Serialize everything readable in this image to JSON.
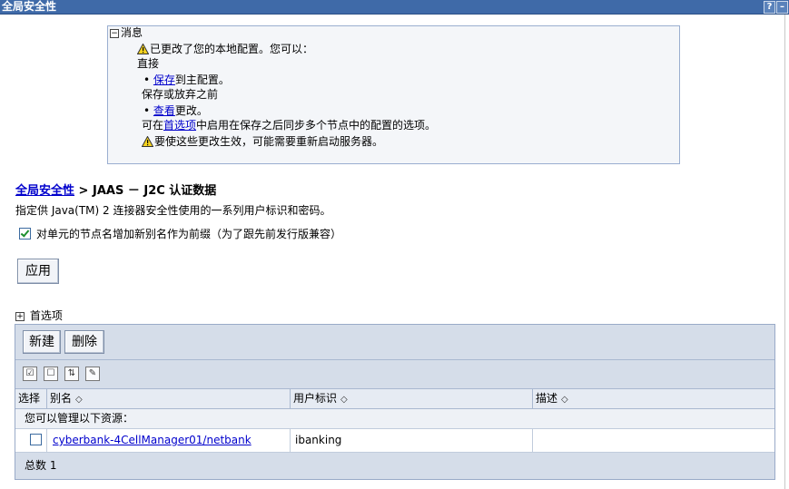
{
  "window": {
    "title": "全局安全性",
    "help_button": "?",
    "minimize_button": "–"
  },
  "message": {
    "header": "消息",
    "line1": "已更改了您的本地配置。您可以：",
    "line2": "直接",
    "save_link": "保存",
    "save_suffix": "到主配置。",
    "line4": "保存或放弃之前",
    "review_link": "查看",
    "review_suffix": "更改。",
    "pref_prefix": "可在",
    "pref_link": "首选项",
    "pref_suffix": "中启用在保存之后同步多个节点中的配置的选项。",
    "restart": "要使这些更改生效，可能需要重新启动服务器。"
  },
  "breadcrumb": {
    "link": "全局安全性",
    "separator": ">",
    "current": "JAAS － J2C 认证数据"
  },
  "description": "指定供 Java(TM) 2 连接器安全性使用的一系列用户标识和密码。",
  "checkbox": {
    "label": "对单元的节点名增加新别名作为前缀（为了跟先前发行版兼容）",
    "checked": true
  },
  "apply_button": "应用",
  "preferences": {
    "label": "首选项"
  },
  "toolbar": {
    "new_button": "新建",
    "delete_button": "删除"
  },
  "table": {
    "columns": [
      "选择",
      "别名",
      "用户标识",
      "描述"
    ],
    "info_text": "您可以管理以下资源：",
    "rows": [
      {
        "alias": "cyberbank-4CellManager01/netbank",
        "user_id": "ibanking",
        "description": ""
      }
    ],
    "total_label": "总数",
    "total_count": "1"
  }
}
